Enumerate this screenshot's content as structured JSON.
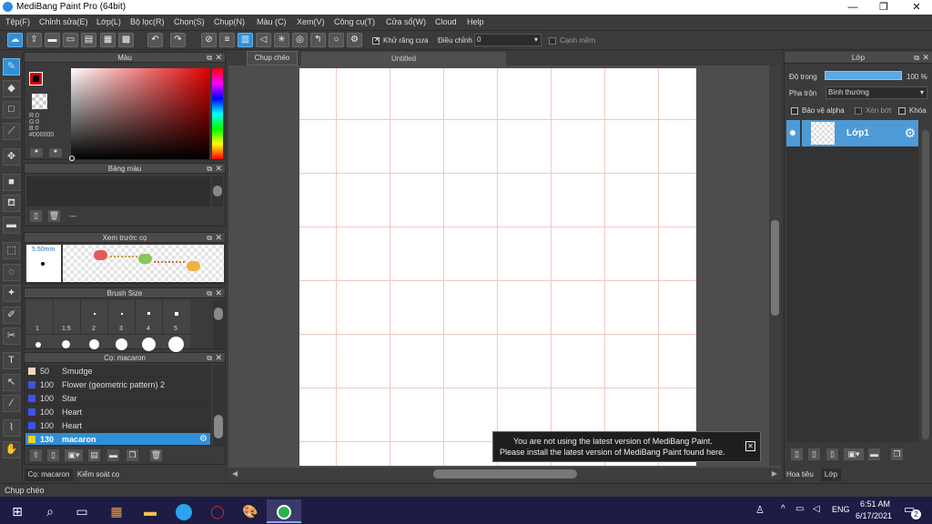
{
  "window": {
    "title": "MediBang Paint Pro (64bit)",
    "min": "—",
    "max": "❐",
    "close": "✕"
  },
  "menu": [
    "Tệp(F)",
    "Chỉnh sửa(E)",
    "Lớp(L)",
    "Bộ lọc(R)",
    "Chọn(S)",
    "Chụp(N)",
    "Màu (C)",
    "Xem(V)",
    "Công cụ(T)",
    "Cửa sổ(W)",
    "Cloud",
    "Help"
  ],
  "toolbar": {
    "antialias_label": "Khử răng cưa",
    "adjust_label": "Điều chỉnh",
    "adjust_value": "0",
    "edge_label": "Cạnh mềm",
    "tooltip": "Chụp chéo"
  },
  "tabs": {
    "document": "Untitled"
  },
  "color_panel": {
    "title": "Màu",
    "r": "R:0",
    "g": "G:0",
    "b": "B:0",
    "hex": "#000000"
  },
  "palette_panel": {
    "title": "Bảng màu",
    "footer": "---"
  },
  "brush_preview": {
    "title": "Xem trước cọ",
    "size": "5.50mm"
  },
  "brush_size": {
    "title": "Brush Size",
    "sizes": [
      "1",
      "1.5",
      "2",
      "3",
      "4",
      "5"
    ]
  },
  "brush_list": {
    "title": "Cọ: macaron",
    "items": [
      {
        "size": "50",
        "name": "Smudge",
        "color": "#f3d6c4"
      },
      {
        "size": "100",
        "name": "Flower (geometric pattern) 2",
        "color": "#3f52e6"
      },
      {
        "size": "100",
        "name": "Star",
        "color": "#3f52e6"
      },
      {
        "size": "100",
        "name": "Heart",
        "color": "#3f52e6"
      },
      {
        "size": "100",
        "name": "Heart",
        "color": "#3f52e6"
      },
      {
        "size": "130",
        "name": "macaron",
        "color": "#f3d128"
      }
    ]
  },
  "bottom_tabs": {
    "left1": "Cọ: macaron",
    "left2": "Kiểm soát cọ",
    "right1": "Hoa tiêu",
    "right2": "Lớp"
  },
  "layer_panel": {
    "title": "Lớp",
    "opacity_label": "Độ trong",
    "opacity_value": "100 %",
    "blend_label": "Pha trộn",
    "blend_value": "Bình thường",
    "alpha_label": "Bảo vệ alpha",
    "clip_label": "Xén bớt",
    "lock_label": "Khóa",
    "layer_name": "Lớp1"
  },
  "notification": {
    "line1": "You are not using the latest version of MediBang Paint.",
    "line2": "Please install the latest version of MediBang Paint found here."
  },
  "status": {
    "text": "Chụp chéo"
  },
  "taskbar": {
    "lang": "ENG",
    "time": "6:51 AM",
    "date": "6/17/2021",
    "notif_count": "2"
  }
}
